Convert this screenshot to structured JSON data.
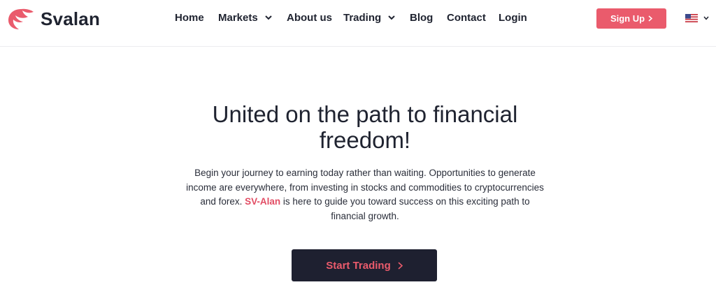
{
  "brand": {
    "name": "Svalan",
    "accent": "#ea5b6c",
    "dark": "#1e2030"
  },
  "nav": {
    "items": [
      {
        "label": "Home",
        "dropdown": false
      },
      {
        "label": "Markets",
        "dropdown": true
      },
      {
        "label": "About us",
        "dropdown": false
      },
      {
        "label": "Trading",
        "dropdown": true
      },
      {
        "label": "Blog",
        "dropdown": false
      },
      {
        "label": "Contact",
        "dropdown": false
      },
      {
        "label": "Login",
        "dropdown": false
      }
    ],
    "signup_label": "Sign Up",
    "language_icon": "us-flag-icon"
  },
  "hero": {
    "title": "United on the path to financial freedom!",
    "text_before": "Begin your journey to earning today rather than waiting. Opportunities to generate income are everywhere, from investing in stocks and commodities to cryptocurrencies and forex. ",
    "highlight": "SV-Alan",
    "text_after": " is here to guide you toward success on this exciting path to financial growth.",
    "cta_label": "Start Trading"
  }
}
